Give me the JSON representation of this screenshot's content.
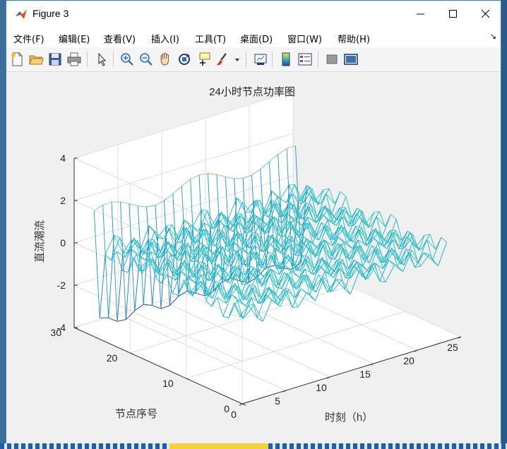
{
  "window": {
    "title": "Figure 3",
    "minimize": "—",
    "maximize": "☐",
    "close": "✕"
  },
  "menu": [
    {
      "label": "文件(F)",
      "key": "file"
    },
    {
      "label": "编辑(E)",
      "key": "edit"
    },
    {
      "label": "查看(V)",
      "key": "view"
    },
    {
      "label": "插入(I)",
      "key": "insert"
    },
    {
      "label": "工具(T)",
      "key": "tools"
    },
    {
      "label": "桌面(D)",
      "key": "desktop"
    },
    {
      "label": "窗口(W)",
      "key": "window"
    },
    {
      "label": "帮助(H)",
      "key": "help"
    }
  ],
  "menu_overflow": "↘",
  "toolbar": [
    "new-figure-icon",
    "open-file-icon",
    "save-icon",
    "print-icon",
    "pointer-icon",
    "zoom-in-icon",
    "zoom-out-icon",
    "pan-icon",
    "rotate-3d-icon",
    "data-cursor-icon",
    "brush-icon",
    "brush-dropdown-icon",
    "link-plot-icon",
    "insert-colorbar-icon",
    "insert-legend-icon",
    "hide-plot-tools-icon",
    "show-plot-tools-icon"
  ],
  "colors": {
    "titlebar": "#ffffff",
    "window_border": "#2d7fd3",
    "figure_bg": "#f0f0f0",
    "mesh_low": "#18bfcf",
    "mesh_high": "#ffff30",
    "mesh_bottom": "#2b2b88"
  },
  "chart_data": {
    "type": "surface",
    "title": "24小时节点功率图",
    "xlabel": "时刻（h）",
    "ylabel": "节点序号",
    "zlabel": "直流潮流",
    "xlim": [
      0,
      25
    ],
    "ylim": [
      0,
      30
    ],
    "zlim": [
      -4,
      4
    ],
    "xticks": [
      "0",
      "5",
      "10",
      "15",
      "20",
      "25"
    ],
    "yticks": [
      "0",
      "10",
      "20",
      "30"
    ],
    "zticks": [
      "-4",
      "-2",
      "0",
      "2",
      "4"
    ],
    "grid": true,
    "colormap": "parula",
    "x": [
      1,
      24
    ],
    "y": [
      1,
      28
    ],
    "typical_ranges": {
      "nodes_1_to_26": [
        -0.9,
        0.8
      ],
      "node_27": [
        -3.8,
        -3.3
      ],
      "node_28": [
        1.0,
        1.8
      ]
    }
  }
}
